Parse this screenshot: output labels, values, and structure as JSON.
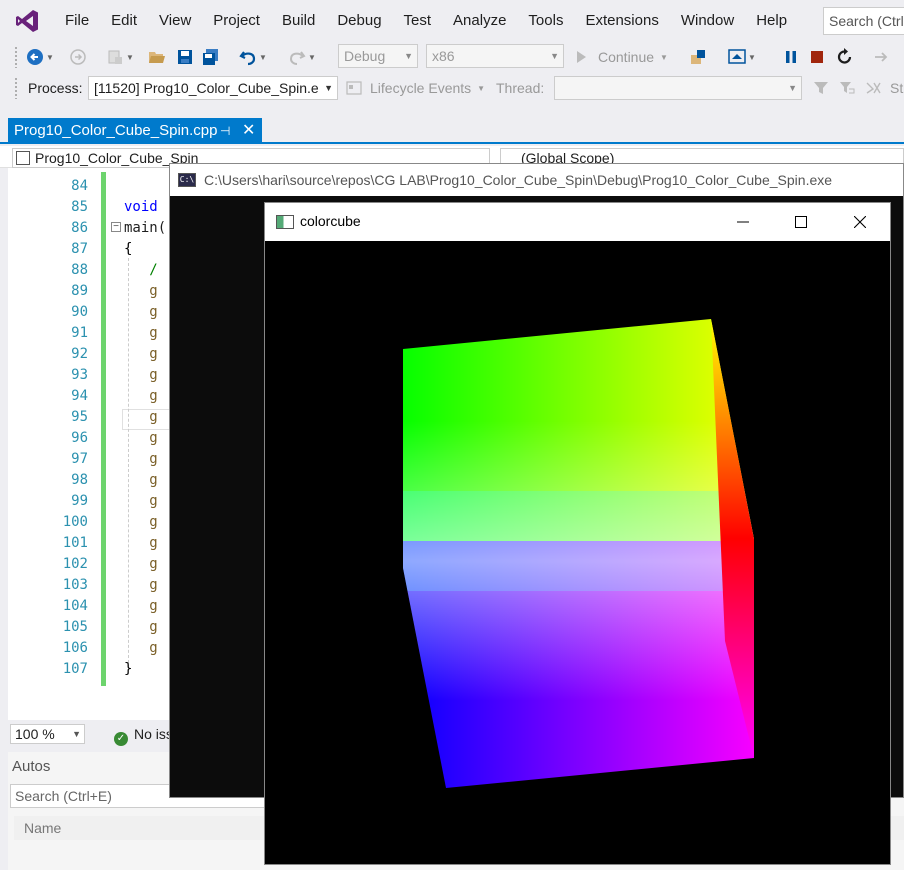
{
  "menu": [
    "File",
    "Edit",
    "View",
    "Project",
    "Build",
    "Debug",
    "Test",
    "Analyze",
    "Tools",
    "Extensions",
    "Window",
    "Help"
  ],
  "search_placeholder": "Search (Ctrl",
  "toolbar": {
    "config": "Debug",
    "platform": "x86",
    "continue_label": "Continue",
    "process_label": "Process:",
    "process_value": "[11520] Prog10_Color_Cube_Spin.e",
    "lifecycle_label": "Lifecycle Events",
    "thread_label": "Thread:",
    "st_label": "St"
  },
  "document": {
    "tab_title": "Prog10_Color_Cube_Spin.cpp",
    "nav_project": "Prog10_Color_Cube_Spin",
    "nav_scope": "(Global Scope)"
  },
  "editor": {
    "lines": [
      {
        "num": "84",
        "code": "",
        "color": "#000000"
      },
      {
        "num": "85",
        "code": "void",
        "color": "#0000ff"
      },
      {
        "num": "86",
        "code": "main(",
        "color": "#1e1e1e"
      },
      {
        "num": "87",
        "code": "{",
        "color": "#000000"
      },
      {
        "num": "88",
        "code": "   /",
        "color": "#008000"
      },
      {
        "num": "89",
        "code": "   g",
        "color": "#795e26"
      },
      {
        "num": "90",
        "code": "   g",
        "color": "#795e26"
      },
      {
        "num": "91",
        "code": "   g",
        "color": "#795e26"
      },
      {
        "num": "92",
        "code": "   g",
        "color": "#795e26"
      },
      {
        "num": "93",
        "code": "   g",
        "color": "#795e26"
      },
      {
        "num": "94",
        "code": "   g",
        "color": "#795e26"
      },
      {
        "num": "95",
        "code": "   g",
        "color": "#795e26"
      },
      {
        "num": "96",
        "code": "   g",
        "color": "#795e26"
      },
      {
        "num": "97",
        "code": "   g",
        "color": "#795e26"
      },
      {
        "num": "98",
        "code": "   g",
        "color": "#795e26"
      },
      {
        "num": "99",
        "code": "   g",
        "color": "#795e26"
      },
      {
        "num": "100",
        "code": "   g",
        "color": "#795e26"
      },
      {
        "num": "101",
        "code": "   g",
        "color": "#795e26"
      },
      {
        "num": "102",
        "code": "   g",
        "color": "#795e26"
      },
      {
        "num": "103",
        "code": "   g",
        "color": "#795e26"
      },
      {
        "num": "104",
        "code": "   g",
        "color": "#795e26"
      },
      {
        "num": "105",
        "code": "   g",
        "color": "#795e26"
      },
      {
        "num": "106",
        "code": "   g",
        "color": "#795e26"
      },
      {
        "num": "107",
        "code": "}",
        "color": "#000000"
      }
    ],
    "zoom": "100 %",
    "issues": "No iss"
  },
  "autos": {
    "title": "Autos",
    "search_placeholder": "Search (Ctrl+E)",
    "column_name": "Name"
  },
  "console": {
    "title": "C:\\Users\\hari\\source\\repos\\CG LAB\\Prog10_Color_Cube_Spin\\Debug\\Prog10_Color_Cube_Spin.exe",
    "icon_text": "C:\\"
  },
  "cube_window": {
    "title": "colorcube"
  },
  "colors": {
    "accent": "#007acc",
    "change_bar": "#6dd46d",
    "line_numbers": "#2b91af"
  }
}
